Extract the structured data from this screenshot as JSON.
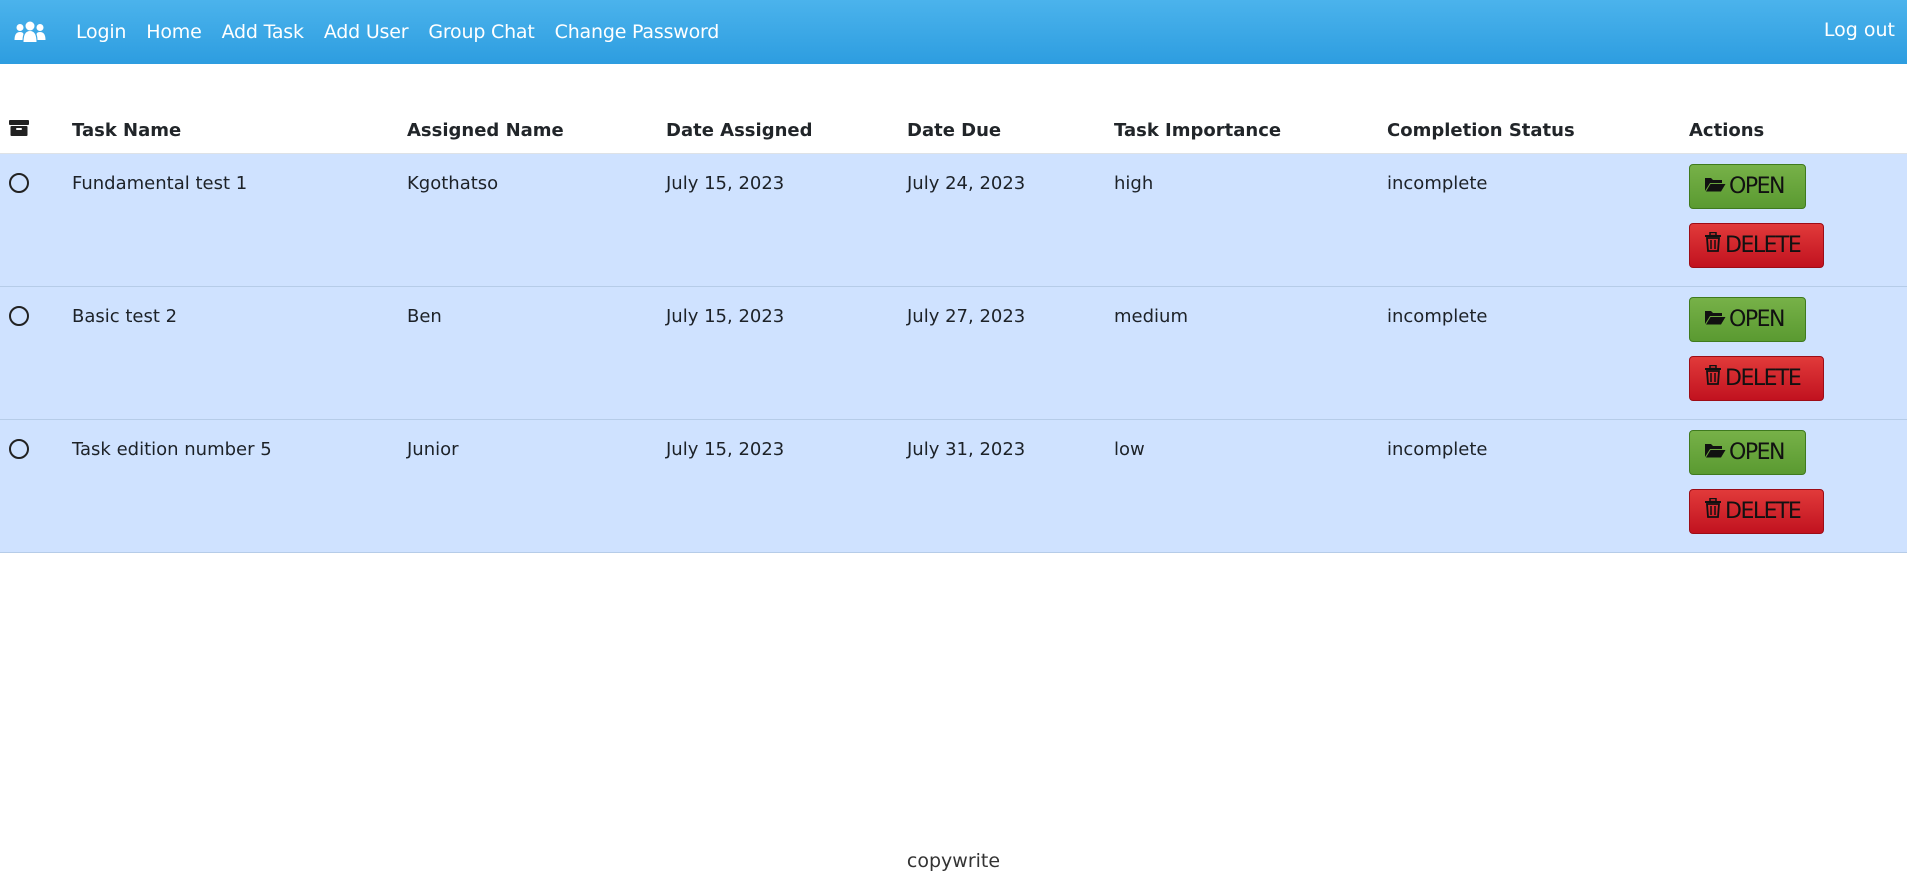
{
  "nav": {
    "logo_icon": "users-icon",
    "links": [
      "Login",
      "Home",
      "Add Task",
      "Add User",
      "Group Chat",
      "Change Password"
    ],
    "logout": "Log out"
  },
  "table": {
    "select_header_icon": "archive-icon",
    "headers": [
      "Task Name",
      "Assigned Name",
      "Date Assigned",
      "Date Due",
      "Task Importance",
      "Completion Status",
      "Actions"
    ],
    "rows": [
      {
        "task_name": "Fundamental test 1",
        "assigned_name": "Kgothatso",
        "date_assigned": "July 15, 2023",
        "date_due": "July 24, 2023",
        "importance": "high",
        "status": "incomplete"
      },
      {
        "task_name": "Basic test 2",
        "assigned_name": "Ben",
        "date_assigned": "July 15, 2023",
        "date_due": "July 27, 2023",
        "importance": "medium",
        "status": "incomplete"
      },
      {
        "task_name": "Task edition number 5",
        "assigned_name": "Junior",
        "date_assigned": "July 15, 2023",
        "date_due": "July 31, 2023",
        "importance": "low",
        "status": "incomplete"
      }
    ],
    "open_label": "OPEN",
    "delete_label": "DELETE",
    "open_icon": "folder-open-icon",
    "delete_icon": "trash-icon"
  },
  "colors": {
    "navbar": "#2d9de0",
    "row_bg": "#cfe2ff",
    "open_button": "#5a9a31",
    "delete_button": "#c1121f"
  },
  "footer": {
    "text": "copywrite"
  }
}
